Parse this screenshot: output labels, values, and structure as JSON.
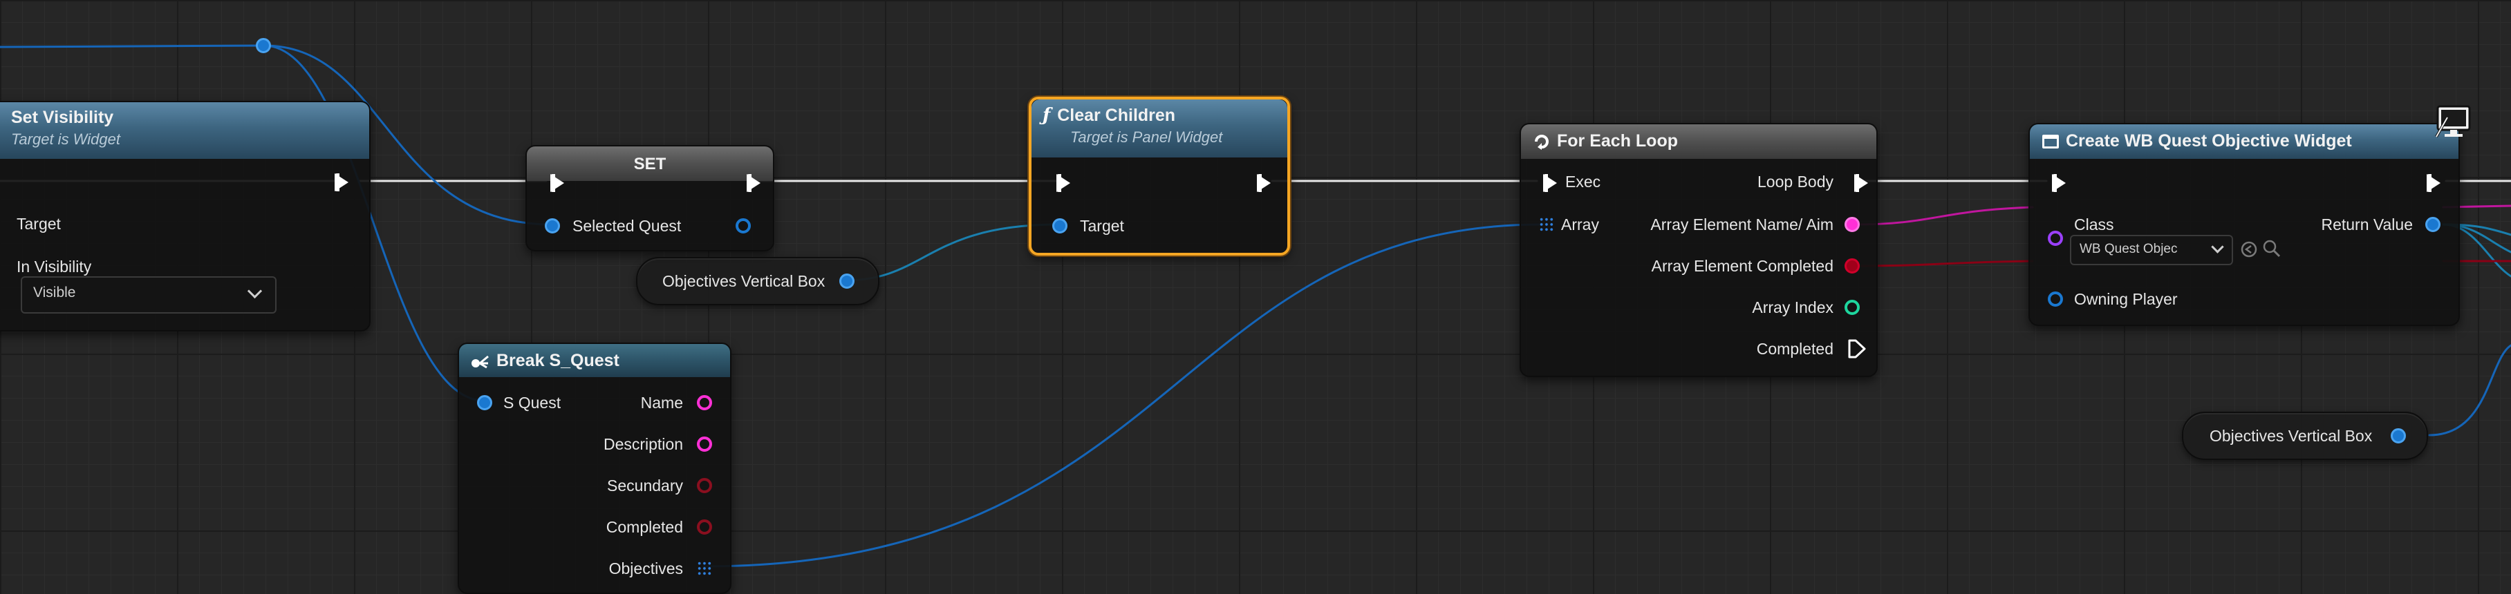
{
  "nodes": {
    "set_visibility": {
      "title": "Set Visibility",
      "subtitle": "Target is Widget",
      "pin_target": "Target",
      "pin_in_visibility": "In Visibility",
      "visibility_value": "Visible"
    },
    "set": {
      "title": "SET",
      "pin_selected_quest": "Selected Quest"
    },
    "objectives_vbox_1": {
      "label": "Objectives Vertical Box"
    },
    "clear_children": {
      "title": "Clear Children",
      "subtitle": "Target is Panel Widget",
      "pin_target": "Target"
    },
    "break_s_quest": {
      "title": "Break S_Quest",
      "pin_s_quest": "S Quest",
      "pin_name": "Name",
      "pin_description": "Description",
      "pin_secundary": "Secundary",
      "pin_completed": "Completed",
      "pin_objectives": "Objectives"
    },
    "for_each_loop": {
      "title": "For Each Loop",
      "pin_exec": "Exec",
      "pin_array": "Array",
      "pin_loop_body": "Loop Body",
      "pin_elem_name": "Array Element Name/ Aim",
      "pin_elem_completed": "Array Element Completed",
      "pin_array_index": "Array Index",
      "pin_completed": "Completed"
    },
    "create_widget": {
      "title": "Create WB Quest Objective Widget",
      "pin_class": "Class",
      "class_value": "WB Quest Objec",
      "pin_return_value": "Return Value",
      "pin_owning_player": "Owning Player"
    },
    "objectives_vbox_2": {
      "label": "Objectives Vertical Box"
    }
  },
  "colors": {
    "exec": "#ffffff",
    "object": "#1a78d0",
    "string": "#ff30d6",
    "bool": "#a0001a",
    "int": "#1ed69e",
    "class": "#9b40ff",
    "selected_outline": "#f5a623"
  },
  "icons": {
    "function": "function-icon",
    "loop": "loop-macro-icon",
    "break": "break-struct-icon",
    "widget": "widget-icon",
    "monitor": "monitor-icon"
  }
}
